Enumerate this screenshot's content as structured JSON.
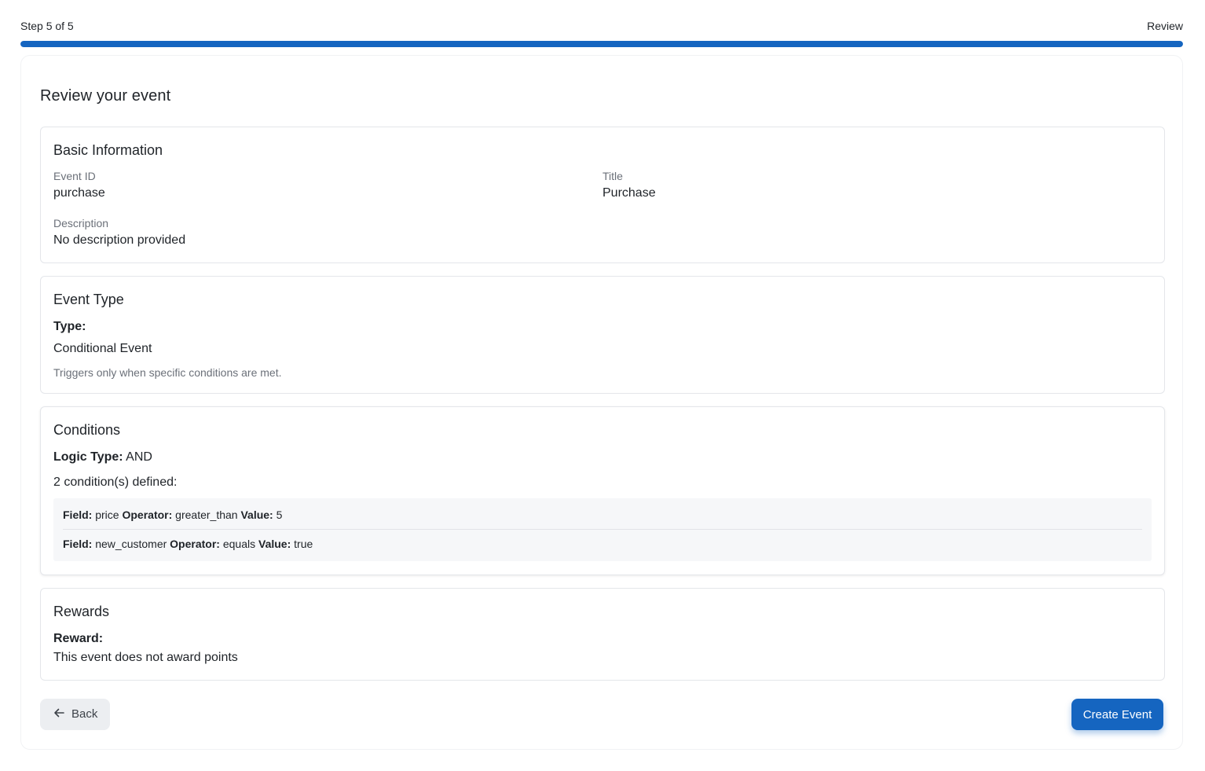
{
  "stepper": {
    "step_text": "Step 5 of 5",
    "step_name": "Review",
    "progress_percent": 100,
    "accent_color": "#1565c0"
  },
  "page": {
    "title": "Review your event"
  },
  "basic_info": {
    "heading": "Basic Information",
    "event_id_label": "Event ID",
    "event_id_value": "purchase",
    "title_label": "Title",
    "title_value": "Purchase",
    "description_label": "Description",
    "description_value": "No description provided"
  },
  "event_type": {
    "heading": "Event Type",
    "type_label": "Type:",
    "type_value": "Conditional Event",
    "type_note": "Triggers only when specific conditions are met."
  },
  "conditions": {
    "heading": "Conditions",
    "logic_label": "Logic Type:",
    "logic_value": "AND",
    "count_text": "2 condition(s) defined:",
    "field_label": "Field:",
    "operator_label": "Operator:",
    "value_label": "Value:",
    "items": [
      {
        "field": "price",
        "operator": "greater_than",
        "value": "5"
      },
      {
        "field": "new_customer",
        "operator": "equals",
        "value": "true"
      }
    ]
  },
  "rewards": {
    "heading": "Rewards",
    "reward_label": "Reward:",
    "reward_value": "This event does not award points"
  },
  "actions": {
    "back_icon": "arrow-left-icon",
    "back_label": "Back",
    "create_label": "Create Event"
  }
}
